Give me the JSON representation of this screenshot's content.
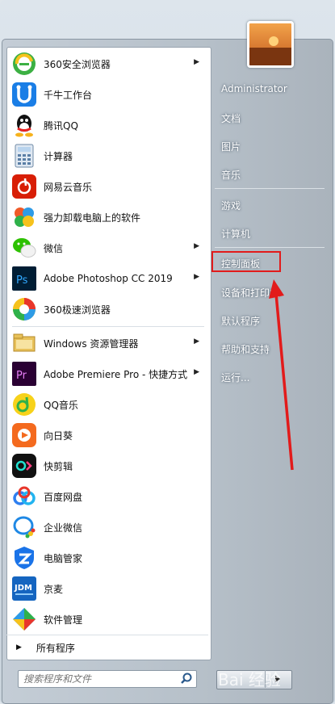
{
  "programs": [
    {
      "label": "360安全浏览器",
      "submenu": true
    },
    {
      "label": "千牛工作台",
      "submenu": false
    },
    {
      "label": "腾讯QQ",
      "submenu": false
    },
    {
      "label": "计算器",
      "submenu": false
    },
    {
      "label": "网易云音乐",
      "submenu": false
    },
    {
      "label": "强力卸载电脑上的软件",
      "submenu": false
    },
    {
      "label": "微信",
      "submenu": true
    },
    {
      "label": "Adobe Photoshop CC 2019",
      "submenu": true
    },
    {
      "label": "360极速浏览器",
      "submenu": false
    },
    {
      "label": "Windows 资源管理器",
      "submenu": true
    },
    {
      "label": "Adobe Premiere Pro - 快捷方式",
      "submenu": true
    },
    {
      "label": "QQ音乐",
      "submenu": false
    },
    {
      "label": "向日葵",
      "submenu": false
    },
    {
      "label": "快剪辑",
      "submenu": false
    },
    {
      "label": "百度网盘",
      "submenu": false
    },
    {
      "label": "企业微信",
      "submenu": false
    },
    {
      "label": "电脑管家",
      "submenu": false
    },
    {
      "label": "京麦",
      "submenu": false
    },
    {
      "label": "软件管理",
      "submenu": false
    }
  ],
  "all_programs_label": "所有程序",
  "search": {
    "placeholder": "搜索程序和文件"
  },
  "right_menu": {
    "user": "Administrator",
    "documents": "文档",
    "pictures": "图片",
    "music": "音乐",
    "games": "游戏",
    "computer": "计算机",
    "control_panel": "控制面板",
    "devices_printers": "设备和打印机",
    "default_programs": "默认程序",
    "help_support": "帮助和支持",
    "run": "运行..."
  },
  "icon_names": [
    "360-browser-icon",
    "qianniu-icon",
    "qq-icon",
    "calculator-icon",
    "netease-music-icon",
    "uninstall-icon",
    "wechat-icon",
    "photoshop-icon",
    "360-speed-browser-icon",
    "explorer-icon",
    "premiere-icon",
    "qq-music-icon",
    "sunflower-icon",
    "kuaijianji-icon",
    "baidu-netdisk-icon",
    "wecom-icon",
    "pc-manager-icon",
    "jingmai-icon",
    "software-manager-icon"
  ],
  "annotation_color": "#e21b1b",
  "watermark": "Bai 经验"
}
